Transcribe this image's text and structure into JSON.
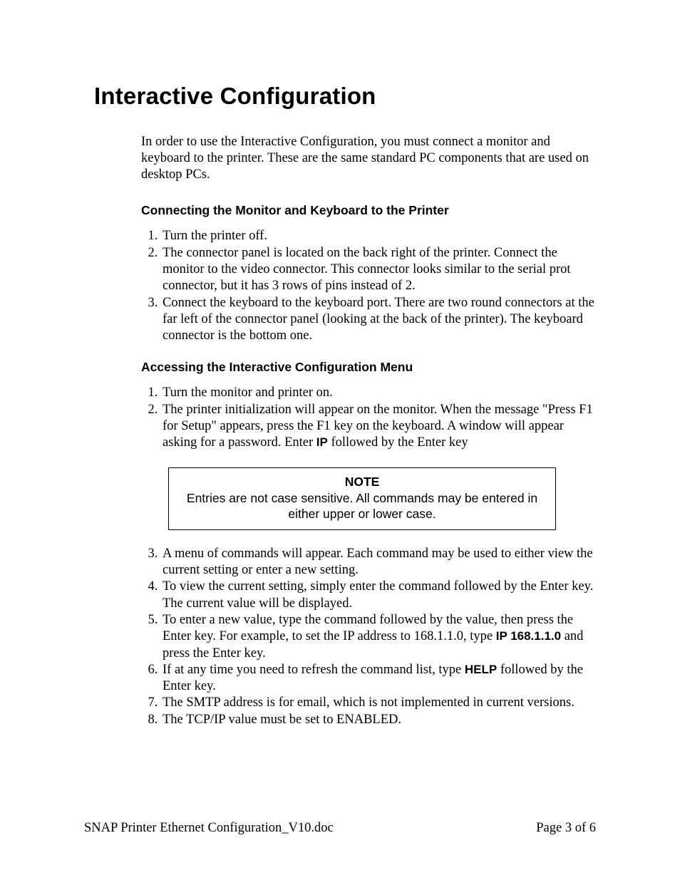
{
  "title": "Interactive Configuration",
  "intro": "In order to use the Interactive Configuration, you must connect a monitor and keyboard to the printer. These are the same standard PC components that are used on desktop PCs.",
  "section1": {
    "heading": "Connecting the Monitor and Keyboard to the Printer",
    "items": [
      "Turn the printer off.",
      "The connector panel is located on the back right of the printer. Connect the monitor to the video connector. This connector looks similar to the serial prot connector, but it has 3 rows of pins instead of 2.",
      "Connect the keyboard to the keyboard port. There are two round connectors at the far left of the connector panel (looking at the back of the printer). The keyboard connector is the bottom one."
    ]
  },
  "section2": {
    "heading": "Accessing the Interactive Configuration Menu",
    "items_a": {
      "1": "Turn the monitor and printer on.",
      "2_pre": "The printer initialization will appear on the monitor. When the message \"Press F1 for Setup\" appears, press the F1 key on the keyboard. A window will appear asking for a password. Enter ",
      "2_cmd": "IP",
      "2_post": " followed by the Enter key"
    },
    "note": {
      "label": "NOTE",
      "text": "Entries are not case sensitive. All commands may be entered in either upper or lower case."
    },
    "items_b": {
      "3": "A menu of commands will appear. Each command may be used to either view the current setting or enter a new setting.",
      "4": "To view the current setting, simply enter the command followed by the Enter key. The current value will be displayed.",
      "5_pre": "To enter a new value, type the command followed by the value, then press the Enter key. For example, to set the IP address to 168.1.1.0, type ",
      "5_cmd": "IP 168.1.1.0",
      "5_post": " and press the Enter key.",
      "6_pre": "If at any time you need to refresh the command list, type ",
      "6_cmd": "HELP",
      "6_post": " followed by the Enter key.",
      "7": "The SMTP address is for email, which is not implemented in current versions.",
      "8": "The TCP/IP value must be set to ENABLED."
    }
  },
  "footer": {
    "left": "SNAP Printer Ethernet Configuration_V10.doc",
    "right": "Page 3 of 6"
  }
}
